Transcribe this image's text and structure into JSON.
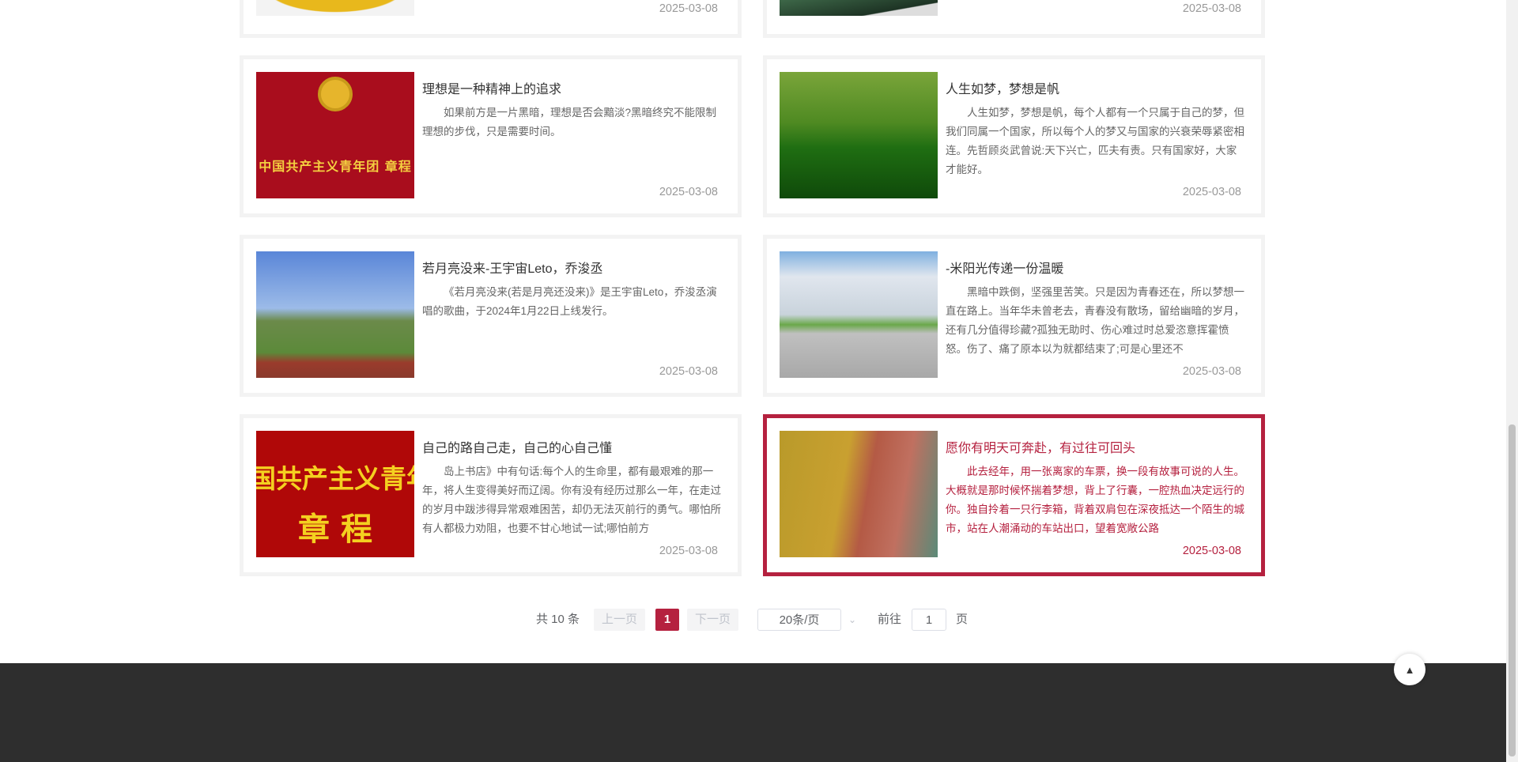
{
  "top_row": [
    {
      "date": "2025-03-08"
    },
    {
      "date": "2025-03-08"
    }
  ],
  "articles": [
    {
      "title": "理想是一种精神上的追求",
      "body": "如果前方是一片黑暗，理想是否会黯淡?黑暗终究不能限制理想的步伐，只是需要时间。",
      "date": "2025-03-08",
      "image": "中国共产主义青年团 章程",
      "image_sub": "章 程"
    },
    {
      "title": "人生如梦，梦想是帆",
      "body": "人生如梦，梦想是帆，每个人都有一个只属于自己的梦，但我们同属一个国家，所以每个人的梦又与国家的兴衰荣辱紧密相连。先哲顾炎武曾说:天下兴亡，匹夫有责。只有国家好，大家才能好。",
      "date": "2025-03-08"
    },
    {
      "title": "若月亮没来-王宇宙Leto，乔浚丞",
      "body": "《若月亮没来(若是月亮还没来)》是王宇宙Leto，乔浚丞演唱的歌曲，于2024年1月22日上线发行。",
      "date": "2025-03-08"
    },
    {
      "title": "-米阳光传递一份温暖",
      "body": "黑暗中跌倒，坚强里苦笑。只是因为青春还在，所以梦想一直在路上。当年华未曾老去，青春没有散场，留给幽暗的岁月，还有几分值得珍藏?孤独无助时、伤心难过时总爱恣意挥霍愤怒。伤了、痛了原本以为就都结束了;可是心里还不",
      "date": "2025-03-08"
    },
    {
      "title": "自己的路自己走，自己的心自己懂",
      "body": "岛上书店》中有句话:每个人的生命里，都有最艰难的那一年，将人生变得美好而辽阔。你有没有经历过那么一年，在走过的岁月中跋涉得异常艰难困苦，却仍无法灭前行的勇气。哪怕所有人都极力劝阻，也要不甘心地试一试;哪怕前方",
      "date": "2025-03-08",
      "image": "国共产主义青年",
      "image_sub": "章 程"
    },
    {
      "title": "愿你有明天可奔赴，有过往可回头",
      "body": "此去经年，用一张离家的车票，换一段有故事可说的人生。大概就是那时候怀揣着梦想，背上了行囊，一腔热血决定远行的你。独自拎着一只行李箱，背着双肩包在深夜抵达一个陌生的城市，站在人潮涌动的车站出口，望着宽敞公路",
      "date": "2025-03-08"
    }
  ],
  "pagination": {
    "total": "共 10 条",
    "prev": "上一页",
    "current": "1",
    "next": "下一页",
    "page_size": "20条/页",
    "goto": "前往",
    "goto_value": "1",
    "page_unit": "页"
  },
  "colors": {
    "accent": "#b5213f",
    "footer": "#2e2e2e"
  }
}
